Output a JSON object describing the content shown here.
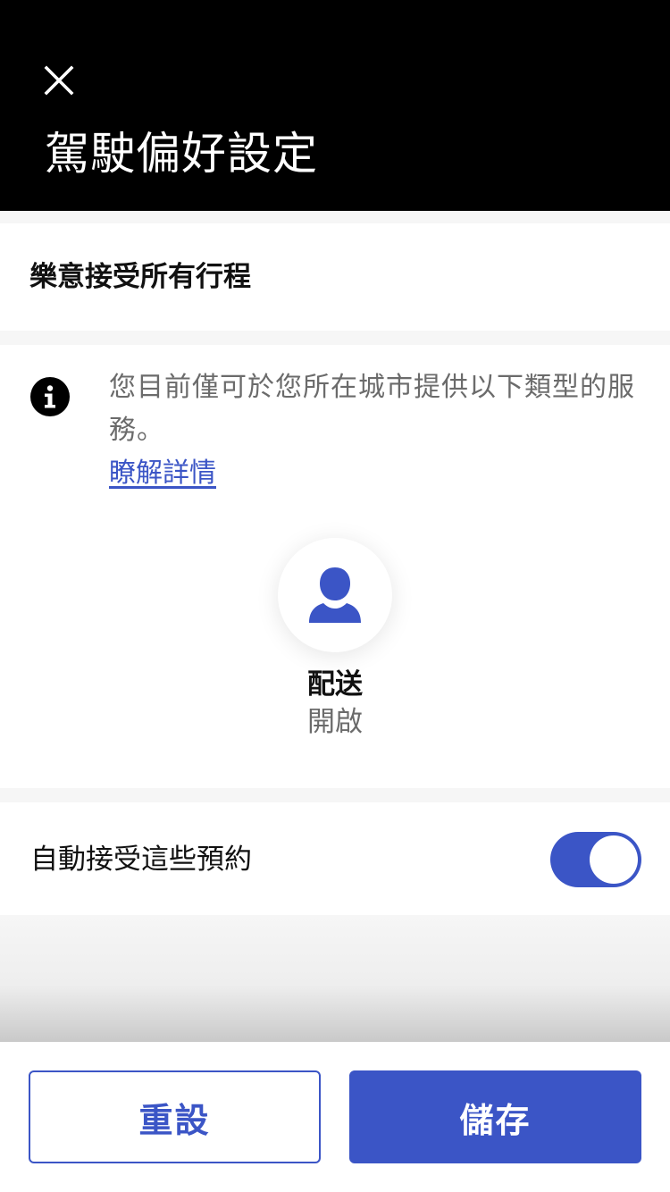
{
  "header": {
    "title": "駕駛偏好設定",
    "close_icon": "close-icon"
  },
  "accept_all": {
    "label": "樂意接受所有行程"
  },
  "info": {
    "icon": "info-icon",
    "text": "您目前僅可於您所在城市提供以下類型的服務。",
    "link": "瞭解詳情"
  },
  "service": {
    "icon": "person-icon",
    "name": "配送",
    "status": "開啟"
  },
  "auto_accept": {
    "label": "自動接受這些預約",
    "enabled": true
  },
  "footer": {
    "reset_label": "重設",
    "save_label": "儲存"
  },
  "colors": {
    "accent": "#3b55c6",
    "header_bg": "#000000"
  }
}
